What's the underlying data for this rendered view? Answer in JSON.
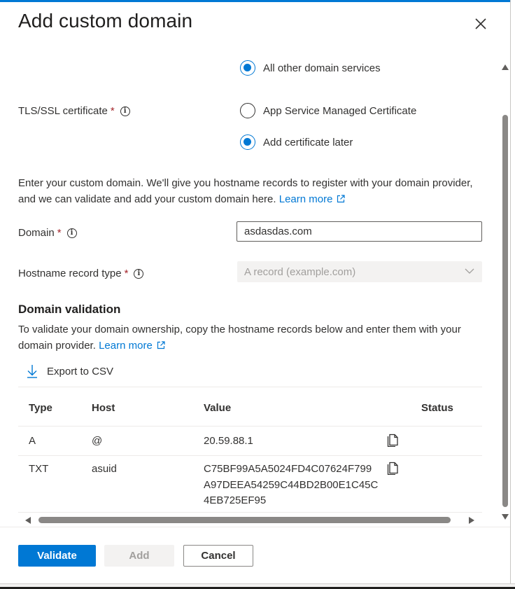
{
  "dialog": {
    "title": "Add custom domain"
  },
  "certificate": {
    "label": "TLS/SSL certificate",
    "required_mark": "*",
    "options": [
      {
        "label": "All other domain services",
        "checked": true
      },
      {
        "label": "App Service Managed Certificate",
        "checked": false
      },
      {
        "label": "Add certificate later",
        "checked": true
      }
    ]
  },
  "intro": {
    "text": "Enter your custom domain. We'll give you hostname records to register with your domain provider, and we can validate and add your custom domain here.",
    "link": "Learn more"
  },
  "domain": {
    "label": "Domain",
    "required_mark": "*",
    "value": "asdasdas.com"
  },
  "hostname_record": {
    "label": "Hostname record type",
    "required_mark": "*",
    "selected": "A record (example.com)"
  },
  "validation": {
    "title": "Domain validation",
    "text": "To validate your domain ownership, copy the hostname records below and enter them with your domain provider.",
    "link": "Learn more",
    "export_label": "Export to CSV"
  },
  "records_table": {
    "columns": [
      "Type",
      "Host",
      "Value",
      "Status"
    ],
    "rows": [
      {
        "type": "A",
        "host": "@",
        "value_lines": [
          "20.59.88.1"
        ]
      },
      {
        "type": "TXT",
        "host": "asuid",
        "value_lines": [
          "C75BF99A5A5024FD4C07624F799",
          "A97DEEA54259C44BD2B00E1C45C",
          "4EB725EF95"
        ]
      }
    ]
  },
  "footer": {
    "validate_label": "Validate",
    "add_label": "Add",
    "cancel_label": "Cancel"
  },
  "colors": {
    "accent": "#0078d4",
    "required": "#a4262c",
    "disabled_bg": "#f3f2f1",
    "disabled_text": "#a19f9d"
  }
}
